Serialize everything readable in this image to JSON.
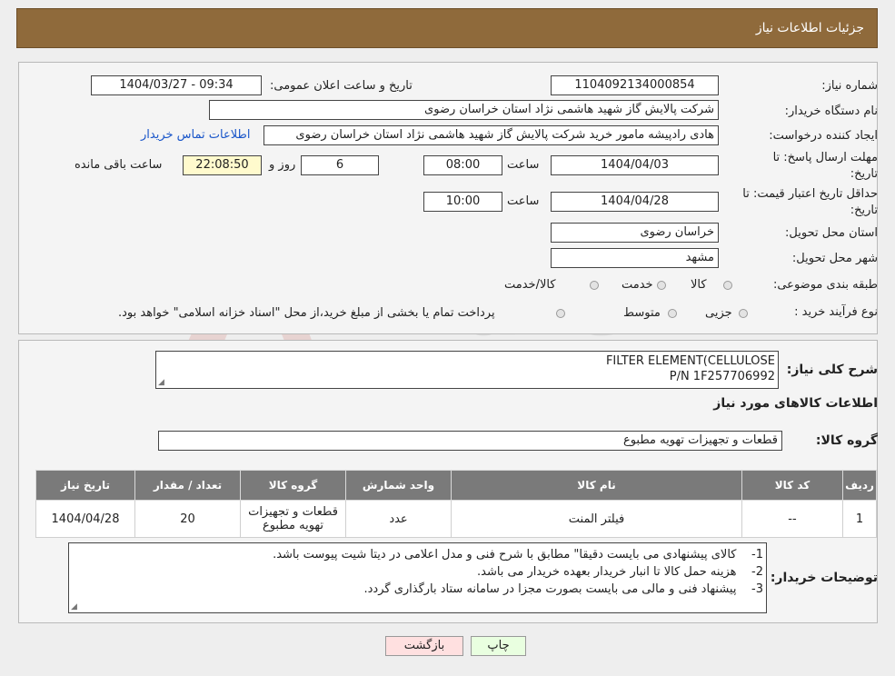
{
  "header": {
    "title": "جزئیات اطلاعات نیاز"
  },
  "fields": {
    "need_number_label": "شماره نیاز:",
    "need_number": "1104092134000854",
    "announce_label": "تاریخ و ساعت اعلان عمومی:",
    "announce_value": "1404/03/27 - 09:34",
    "buyer_label": "نام دستگاه خریدار:",
    "buyer_value": "شرکت پالایش گاز شهید هاشمی نژاد   استان خراسان رضوی",
    "creator_label": "ایجاد کننده درخواست:",
    "creator_value": "هادی رادپیشه مامور خرید شرکت پالایش گاز شهید هاشمی نژاد   استان خراسان رضوی",
    "contact_link": "اطلاعات تماس خریدار",
    "deadline_label_1": "مهلت ارسال پاسخ: تا",
    "deadline_label_2": "تاریخ:",
    "deadline_date": "1404/04/03",
    "time_label": "ساعت",
    "deadline_time": "08:00",
    "days_value": "6",
    "days_label": "روز و",
    "remaining_value": "22:08:50",
    "remaining_label": "ساعت باقی مانده",
    "validity_label_1": "حداقل تاریخ اعتبار قیمت: تا",
    "validity_label_2": "تاریخ:",
    "validity_date": "1404/04/28",
    "validity_time": "10:00",
    "province_label": "استان محل تحویل:",
    "province_value": "خراسان رضوی",
    "city_label": "شهر محل تحویل:",
    "city_value": "مشهد",
    "category_label": "طبقه بندی موضوعی:",
    "category_options": [
      "کالا",
      "خدمت",
      "کالا/خدمت"
    ],
    "process_label": "نوع فرآیند خرید :",
    "process_options": [
      "جزیی",
      "متوسط"
    ],
    "process_note": "پرداخت تمام یا بخشی از مبلغ خرید،از محل \"اسناد خزانه اسلامی\" خواهد بود."
  },
  "description": {
    "label": "شرح کلی نیاز:",
    "line1": "FILTER ELEMENT(CELLULOSE",
    "line2": "P/N 1F257706992"
  },
  "goods": {
    "section_title": "اطلاعات کالاهای مورد نیاز",
    "group_label": "گروه کالا:",
    "group_value": "قطعات و تجهیزات تهویه مطبوع"
  },
  "table": {
    "headers": [
      "ردیف",
      "کد کالا",
      "نام کالا",
      "واحد شمارش",
      "گروه کالا",
      "تعداد / مقدار",
      "تاریخ نیاز"
    ],
    "rows": [
      {
        "row": "1",
        "code": "--",
        "name": "فیلتر المنت",
        "unit": "عدد",
        "group_line1": "قطعات و تجهیزات",
        "group_line2": "تهویه مطبوع",
        "qty": "20",
        "date": "1404/04/28"
      }
    ]
  },
  "notes": {
    "label": "توضیحات خریدار:",
    "items": [
      {
        "num": "1-",
        "text": "کالای پیشنهادی می بایست دقیقا\" مطابق با شرح فنی و مدل اعلامی در دیتا شیت پیوست باشد."
      },
      {
        "num": "2-",
        "text": "هزینه حمل کالا تا انبار خریدار بعهده خریدار می باشد."
      },
      {
        "num": "3-",
        "text": "پیشنهاد فنی و مالی می بایست بصورت مجزا در سامانه ستاد بارگذاری گردد."
      }
    ]
  },
  "buttons": {
    "print": "چاپ",
    "back": "بازگشت"
  },
  "watermark": {
    "text": "AriaTender.neT"
  },
  "colors": {
    "header": "#8f6a3b",
    "table_header": "#7a7a7a",
    "remaining_bg": "#fffacd",
    "back_btn": "#ffe0e0",
    "print_btn": "#e9ffe0"
  }
}
